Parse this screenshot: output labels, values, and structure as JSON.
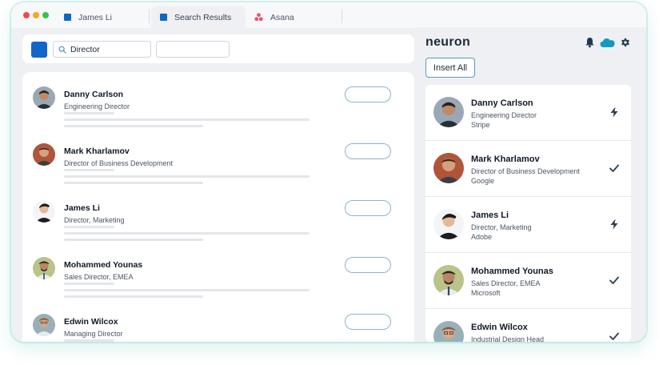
{
  "browser": {
    "traffic_lights": [
      "#f04a4a",
      "#f5a623",
      "#36c24b"
    ],
    "tabs": [
      {
        "label": "James Li",
        "icon": "blue-square-icon"
      },
      {
        "label": "Search Results",
        "icon": "blue-square-icon",
        "active": true
      },
      {
        "label": "Asana",
        "icon": "asana-logo-icon"
      }
    ]
  },
  "search": {
    "query": "Director"
  },
  "results": [
    {
      "name": "Danny Carlson",
      "title": "Engineering Director"
    },
    {
      "name": "Mark Kharlamov",
      "title": "Director of Business Development"
    },
    {
      "name": "James Li",
      "title": "Director, Marketing"
    },
    {
      "name": "Mohammed Younas",
      "title": "Sales Director, EMEA"
    },
    {
      "name": "Edwin Wilcox",
      "title": "Managing Director"
    }
  ],
  "sidebar": {
    "logo": "neuron",
    "icons": [
      "bell-icon",
      "salesforce-cloud-icon",
      "gear-icon"
    ],
    "insert_all_label": "Insert All",
    "contacts": [
      {
        "name": "Danny Carlson",
        "title": "Engineering Director",
        "company": "Stripe",
        "status": "lightning-icon"
      },
      {
        "name": "Mark Kharlamov",
        "title": "Director of Business Development",
        "company": "Google",
        "status": "check-icon"
      },
      {
        "name": "James Li",
        "title": "Director, Marketing",
        "company": "Adobe",
        "status": "lightning-icon"
      },
      {
        "name": "Mohammed Younas",
        "title": "Sales Director, EMEA",
        "company": "Microsoft",
        "status": "check-icon"
      },
      {
        "name": "Edwin Wilcox",
        "title": "Industrial Design Head",
        "company": "",
        "status": "check-icon"
      }
    ]
  },
  "colors": {
    "brand_blue": "#1266c9",
    "accent_teal": "#5a9bb8",
    "status_icon": "#2b3d4f"
  }
}
